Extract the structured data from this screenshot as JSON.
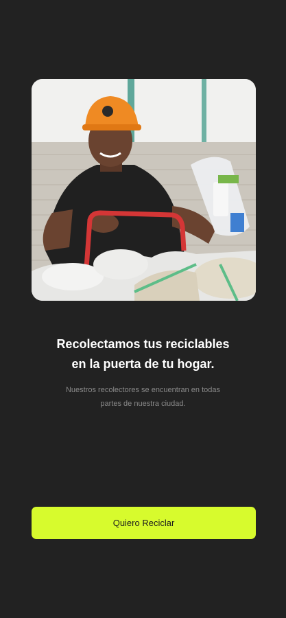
{
  "onboarding": {
    "hero_image": "worker-with-recyclables-photo",
    "headline_line1": "Recolectamos tus reciclables",
    "headline_line2": "en la puerta de tu hogar.",
    "subtext_line1": "Nuestros recolectores se encuentran en todas",
    "subtext_line2": "partes de nuestra ciudad.",
    "cta_label": "Quiero Reciclar"
  },
  "colors": {
    "background": "#222222",
    "accent": "#d7fb2d",
    "headline": "#ffffff",
    "subtext": "#8a8a8a"
  }
}
